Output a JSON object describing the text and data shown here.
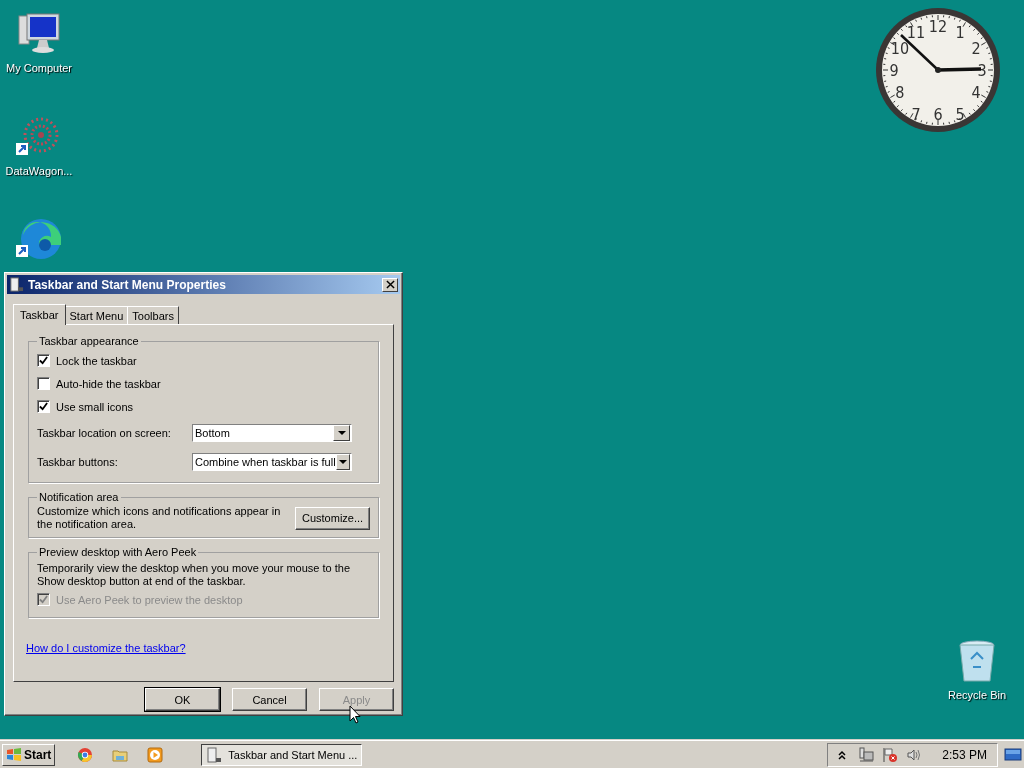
{
  "desktop_icons": [
    {
      "kind": "computer",
      "label": "My Computer",
      "shortcut": false
    },
    {
      "kind": "datawagon",
      "label": "DataWagon...",
      "shortcut": true
    },
    {
      "kind": "edge",
      "shortcut": true
    },
    {
      "kind": "recycle",
      "label": "Recycle Bin",
      "shortcut": false
    }
  ],
  "clock_gadget": {
    "numbers": [
      "11",
      "12",
      "1",
      "10",
      "2",
      "9",
      "3",
      "8",
      "4",
      "7",
      "6",
      "5"
    ]
  },
  "dialog": {
    "title": "Taskbar and Start Menu Properties",
    "tabs": [
      {
        "label": "Taskbar",
        "selected": true
      },
      {
        "label": "Start Menu",
        "selected": false
      },
      {
        "label": "Toolbars",
        "selected": false
      }
    ],
    "appearance": {
      "title": "Taskbar appearance",
      "checkboxes": [
        {
          "label": "Lock the taskbar",
          "checked": true,
          "disabled": false
        },
        {
          "label": "Auto-hide the taskbar",
          "checked": false,
          "disabled": false
        },
        {
          "label": "Use small icons",
          "checked": true,
          "disabled": false
        }
      ],
      "dropdowns": [
        {
          "label": "Taskbar location on screen:",
          "value": "Bottom"
        },
        {
          "label": "Taskbar buttons:",
          "value": "Combine when taskbar is full"
        }
      ]
    },
    "notification": {
      "title": "Notification area",
      "text": "Customize which icons and notifications appear in the notification area.",
      "button": "Customize..."
    },
    "aero_peek": {
      "title": "Preview desktop with Aero Peek",
      "text": "Temporarily view the desktop when you move your mouse to the Show desktop button at end of the taskbar.",
      "checkbox": {
        "label": "Use Aero Peek to preview the desktop",
        "checked": true,
        "disabled": true
      }
    },
    "help_link": "How do I customize the taskbar?",
    "buttons": [
      {
        "label": "OK",
        "default": true,
        "disabled": false
      },
      {
        "label": "Cancel",
        "default": false,
        "disabled": false
      },
      {
        "label": "Apply",
        "default": false,
        "disabled": true
      }
    ]
  },
  "taskbar": {
    "start": "Start",
    "quick_launch": [
      {
        "kind": "chrome"
      },
      {
        "kind": "folder"
      },
      {
        "kind": "media"
      }
    ],
    "tasks": [
      {
        "label": "Taskbar and Start Menu ...",
        "selected": true
      }
    ],
    "tray": {
      "icons": [
        {
          "kind": "chevron"
        },
        {
          "kind": "network"
        },
        {
          "kind": "flag"
        },
        {
          "kind": "volume"
        }
      ],
      "time": "2:53 PM"
    }
  }
}
